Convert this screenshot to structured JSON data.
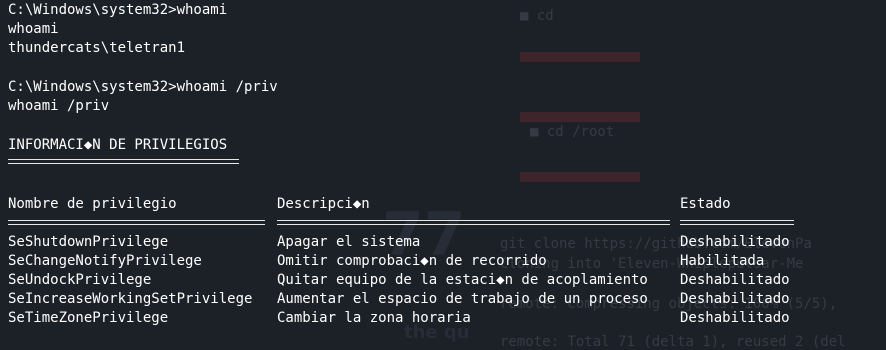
{
  "terminal": {
    "lines": {
      "prompt1": "C:\\Windows\\system32>whoami",
      "echo1": "whoami",
      "user": "thundercats\\teletran1",
      "prompt2": "C:\\Windows\\system32>whoami /priv",
      "echo2": "whoami /priv",
      "section_title": "INFORMACI◆N DE PRIVILEGIOS"
    },
    "table": {
      "headers": {
        "name": "Nombre de privilegio",
        "description": "Descripci◆n",
        "state": "Estado"
      },
      "rows": [
        {
          "name": "SeShutdownPrivilege",
          "description": "Apagar el sistema",
          "state": "Deshabilitado"
        },
        {
          "name": "SeChangeNotifyPrivilege",
          "description": "Omitir comprobaci◆n de recorrido",
          "state": "Habilitada"
        },
        {
          "name": "SeUndockPrivilege",
          "description": "Quitar equipo de la estaci◆n de acoplamiento",
          "state": "Deshabilitado"
        },
        {
          "name": "SeIncreaseWorkingSetPrivilege",
          "description": "Aumentar el espacio de trabajo de un proceso",
          "state": "Deshabilitado"
        },
        {
          "name": "SeTimeZonePrivilege",
          "description": "Cambiar la zona horaria",
          "state": "Deshabilitado"
        }
      ]
    }
  },
  "colors": {
    "background": "#1c2027",
    "text": "#ffffff"
  }
}
